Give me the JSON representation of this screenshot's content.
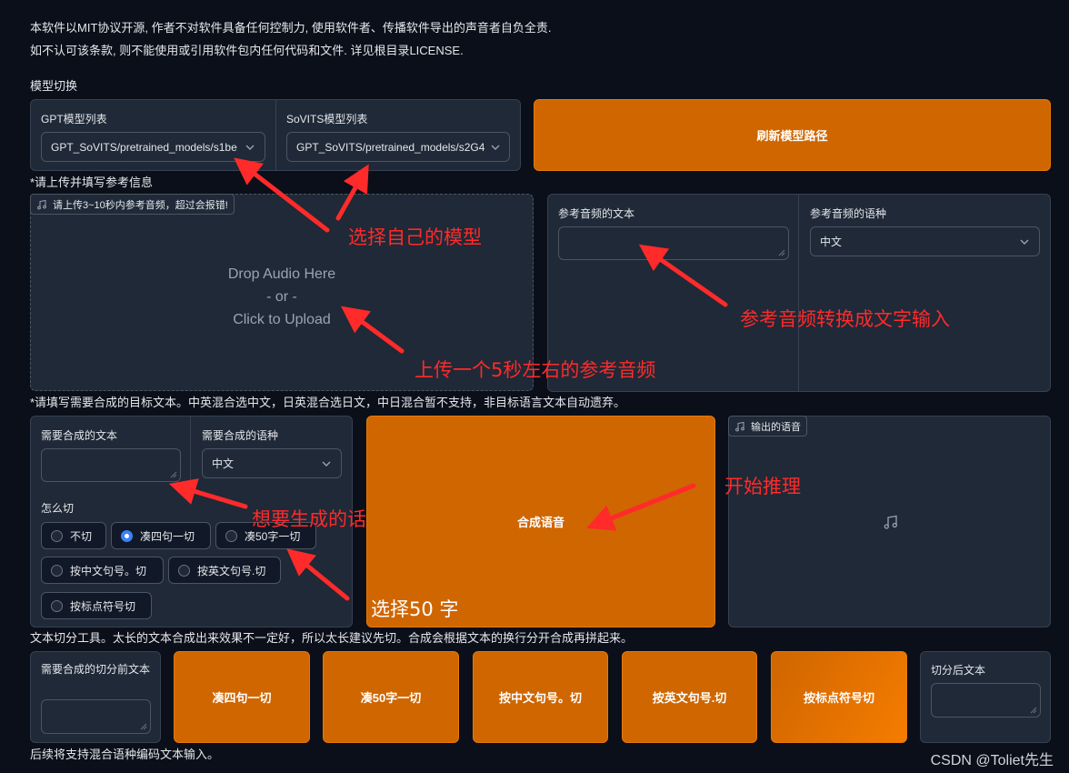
{
  "disclaimer": {
    "line1": "本软件以MIT协议开源, 作者不对软件具备任何控制力, 使用软件者、传播软件导出的声音者自负全责.",
    "line2": "如不认可该条款, 则不能使用或引用软件包内任何代码和文件. 详见根目录LICENSE."
  },
  "model_switch": {
    "title": "模型切换",
    "gpt_label": "GPT模型列表",
    "gpt_value": "GPT_SoVITS/pretrained_models/s1be",
    "sovits_label": "SoVITS模型列表",
    "sovits_value": "GPT_SoVITS/pretrained_models/s2G4",
    "refresh_button": "刷新模型路径"
  },
  "reference": {
    "title": "*请上传并填写参考信息",
    "upload_tag": "请上传3~10秒内参考音频，超过会报错!",
    "drop_line1": "Drop Audio Here",
    "drop_line2": "- or -",
    "drop_line3": "Click to Upload",
    "text_label": "参考音频的文本",
    "text_value": "",
    "lang_label": "参考音频的语种",
    "lang_value": "中文"
  },
  "target": {
    "title": "*请填写需要合成的目标文本。中英混合选中文，日英混合选日文，中日混合暂不支持，非目标语言文本自动遗弃。",
    "text_label": "需要合成的文本",
    "text_value": "",
    "lang_label": "需要合成的语种",
    "lang_value": "中文",
    "cut_label": "怎么切",
    "cut_options": [
      {
        "label": "不切",
        "selected": false
      },
      {
        "label": "凑四句一切",
        "selected": true
      },
      {
        "label": "凑50字一切",
        "selected": false
      },
      {
        "label": "按中文句号。切",
        "selected": false
      },
      {
        "label": "按英文句号.切",
        "selected": false
      },
      {
        "label": "按标点符号切",
        "selected": false
      }
    ],
    "synth_button": "合成语音",
    "output_tag": "输出的语音"
  },
  "split_tool": {
    "title": "文本切分工具。太长的文本合成出来效果不一定好，所以太长建议先切。合成会根据文本的换行分开合成再拼起来。",
    "input_label": "需要合成的切分前文本",
    "input_value": "",
    "buttons": [
      "凑四句一切",
      "凑50字一切",
      "按中文句号。切",
      "按英文句号.切",
      "按标点符号切"
    ],
    "output_label": "切分后文本",
    "output_value": ""
  },
  "footer": {
    "note": "后续将支持混合语种编码文本输入。",
    "watermark": "CSDN @Toliet先生"
  },
  "annotations": {
    "select_model": "选择自己的模型",
    "ref_text": "参考音频转换成文字输入",
    "upload_audio": "上传一个5秒左右的参考音频",
    "target_text": "想要生成的话",
    "start_infer": "开始推理",
    "choose_cut": "选择50 字"
  },
  "colors": {
    "background": "#0b0f19",
    "panel": "#1f2937",
    "accent_orange": "#cf6600",
    "annotation_red": "#ff2a2a",
    "radio_selected": "#3b82f6"
  }
}
